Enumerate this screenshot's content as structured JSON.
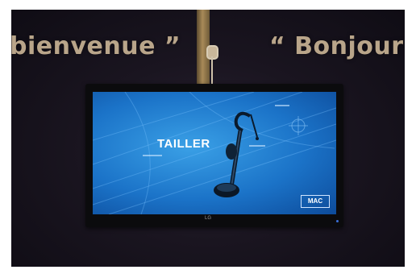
{
  "photo": {
    "wall_text_left": "bienvenue ”",
    "wall_text_right": "“ Bonjour",
    "screen_title": "TAILLER",
    "screen_brand_logo": "MAC",
    "tv_brand": "LG"
  },
  "colors": {
    "wall": "#1a1520",
    "wall_text": "#b9a58a",
    "screen_blue": "#1b73c8",
    "pole": "#a88a58"
  },
  "icons": [
    "string-trimmer-icon",
    "crosshair-icon"
  ]
}
